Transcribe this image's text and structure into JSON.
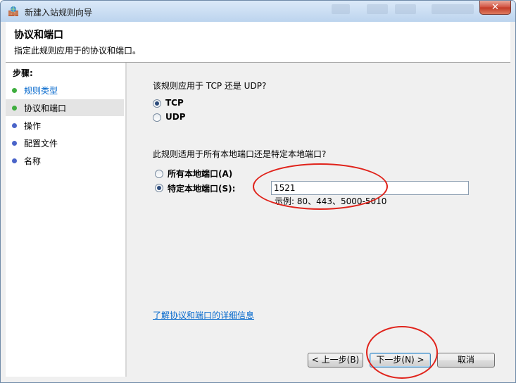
{
  "window": {
    "title": "新建入站规则向导",
    "close_glyph": "✕"
  },
  "header": {
    "title": "协议和端口",
    "subtitle": "指定此规则应用于的协议和端口。"
  },
  "steps": {
    "title": "步骤:",
    "items": [
      {
        "label": "规则类型",
        "dot_color": "#3fae3f"
      },
      {
        "label": "协议和端口",
        "dot_color": "#3fae3f"
      },
      {
        "label": "操作",
        "dot_color": "#4a64c9"
      },
      {
        "label": "配置文件",
        "dot_color": "#4a64c9"
      },
      {
        "label": "名称",
        "dot_color": "#4a64c9"
      }
    ]
  },
  "protocol": {
    "question": "该规则应用于 TCP 还是 UDP?",
    "tcp_label": "TCP",
    "udp_label": "UDP",
    "selected": "TCP"
  },
  "ports": {
    "question": "此规则适用于所有本地端口还是特定本地端口?",
    "all_label": "所有本地端口(A)",
    "specific_label": "特定本地端口(S):",
    "selected": "specific",
    "value": "1521",
    "example": "示例: 80、443、5000-5010"
  },
  "info_link": "了解协议和端口的详细信息",
  "buttons": {
    "back": "< 上一步(B)",
    "next": "下一步(N) >",
    "cancel": "取消"
  },
  "colors": {
    "annotation": "#e0231b",
    "link": "#0066cc"
  }
}
